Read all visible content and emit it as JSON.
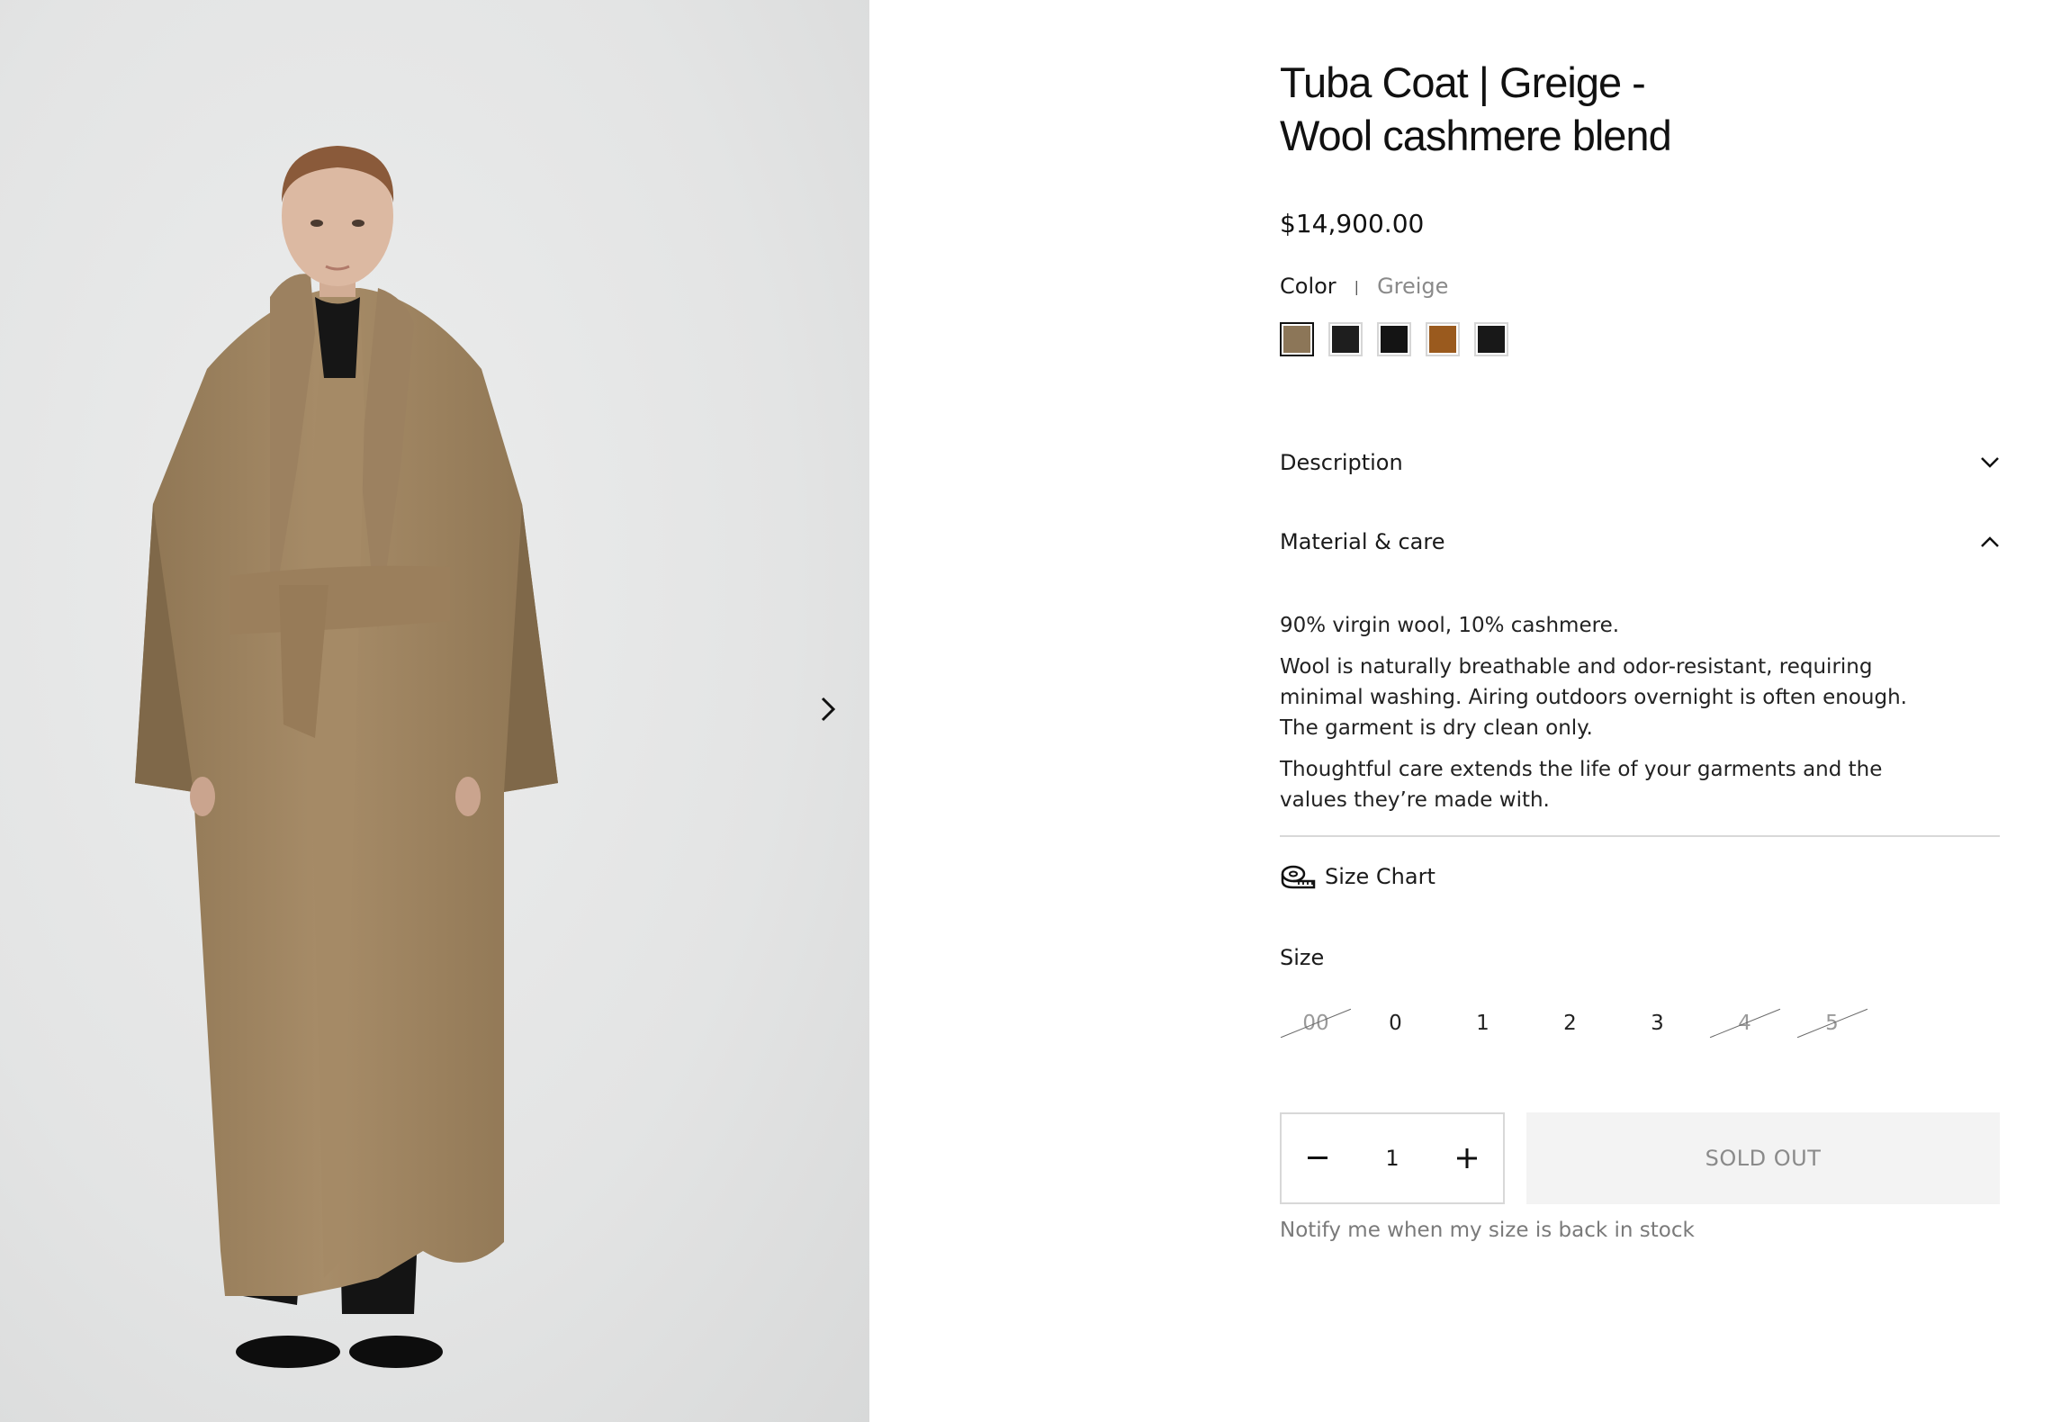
{
  "product": {
    "title_line1": "Tuba Coat | Greige -",
    "title_line2": "Wool cashmere blend",
    "price": "$14,900.00",
    "color_label": "Color",
    "color_separator": "|",
    "selected_color": "Greige",
    "swatches": [
      {
        "name": "Greige",
        "color": "#8c7658",
        "selected": true
      },
      {
        "name": "Black",
        "color": "#1e1e1e"
      },
      {
        "name": "Black",
        "color": "#141414"
      },
      {
        "name": "Camel",
        "color": "#9a5a1e"
      },
      {
        "name": "Black",
        "color": "#181818"
      }
    ]
  },
  "accordion": {
    "description_label": "Description",
    "material_label": "Material & care",
    "material_p1": "90% virgin wool, 10% cashmere.",
    "material_p2": "Wool is naturally breathable and odor-resistant, requiring minimal washing. Airing outdoors overnight is often enough. The garment is dry clean only.",
    "material_p3": "Thoughtful care extends the life of your garments and the values they’re made with."
  },
  "size_chart_label": "Size Chart",
  "size_label": "Size",
  "sizes": [
    {
      "label": "00",
      "available": false
    },
    {
      "label": "0",
      "available": true
    },
    {
      "label": "1",
      "available": true
    },
    {
      "label": "2",
      "available": true
    },
    {
      "label": "3",
      "available": true
    },
    {
      "label": "4",
      "available": false
    },
    {
      "label": "5",
      "available": false
    }
  ],
  "quantity": "1",
  "sold_out_label": "SOLD OUT",
  "notify_text": "Notify me when my size is back in stock",
  "icons": {
    "next": "chevron-right-icon",
    "description_toggle": "chevron-down-icon",
    "material_toggle": "chevron-up-icon",
    "size_chart": "measuring-tape-icon",
    "minus": "minus-icon",
    "plus": "plus-icon"
  }
}
